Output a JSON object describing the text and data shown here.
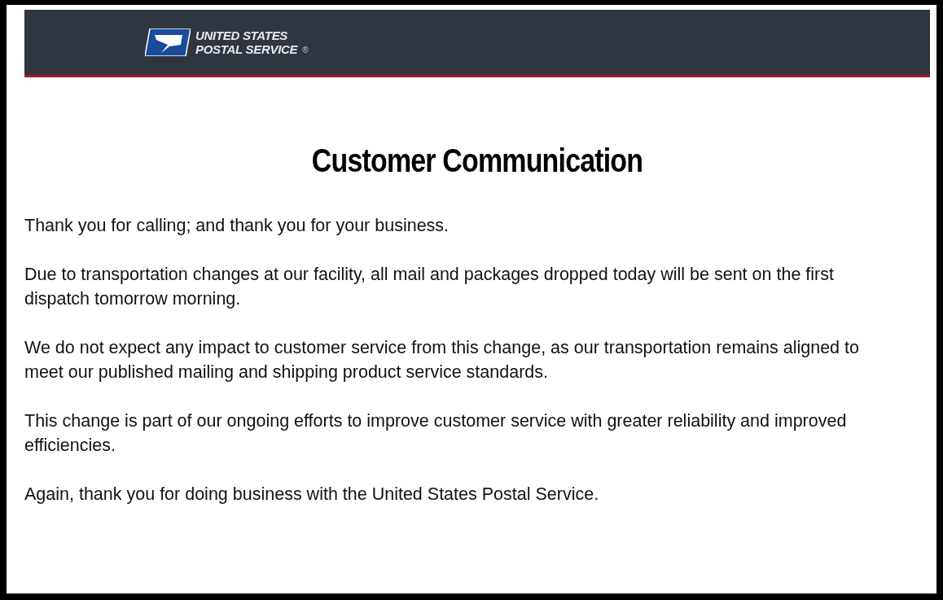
{
  "header": {
    "logo_lines": [
      "UNITED STATES",
      "POSTAL SERVICE"
    ],
    "logo_mark": "®"
  },
  "title": "Customer Communication",
  "paragraphs": [
    "Thank you for calling; and thank you for your business.",
    "Due to transportation changes at our facility, all mail and packages dropped today will be sent on the first dispatch tomorrow morning.",
    "We do not expect any impact to customer service from this change, as our transportation remains aligned to meet our published mailing and shipping product service standards.",
    "This change is part of our ongoing efforts to improve customer service with greater reliability and improved efficiencies.",
    "Again, thank you for doing business with the United States Postal Service."
  ]
}
